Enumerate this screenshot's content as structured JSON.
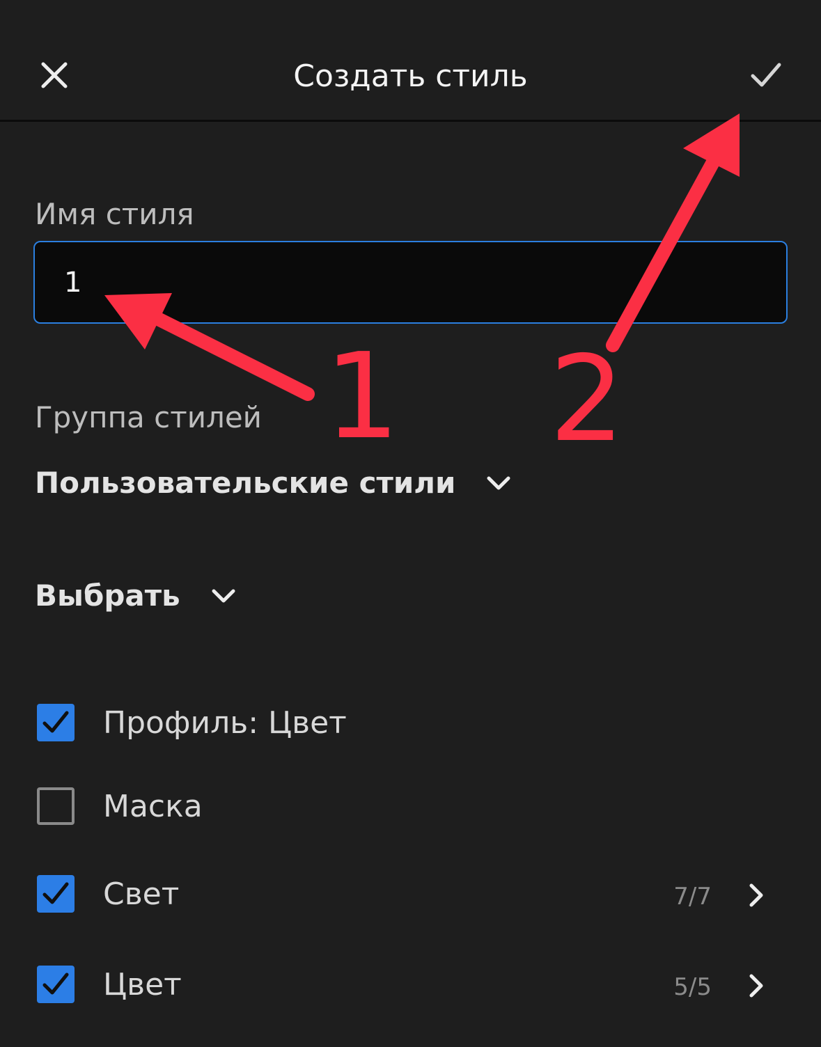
{
  "header": {
    "title": "Создать стиль"
  },
  "style_name": {
    "label": "Имя стиля",
    "value": "1",
    "placeholder": ""
  },
  "style_group": {
    "label": "Группа стилей",
    "selected": "Пользовательские стили"
  },
  "select": {
    "label": "Выбрать"
  },
  "items": [
    {
      "label": "Профиль: Цвет",
      "checked": true,
      "count": ""
    },
    {
      "label": "Маска",
      "checked": false,
      "count": ""
    },
    {
      "label": "Свет",
      "checked": true,
      "count": "7/7"
    },
    {
      "label": "Цвет",
      "checked": true,
      "count": "5/5"
    }
  ],
  "annotations": {
    "one": "1",
    "two": "2"
  },
  "colors": {
    "background": "#1e1e1e",
    "accent": "#2c7ee6",
    "annotation": "#fb2f44"
  }
}
